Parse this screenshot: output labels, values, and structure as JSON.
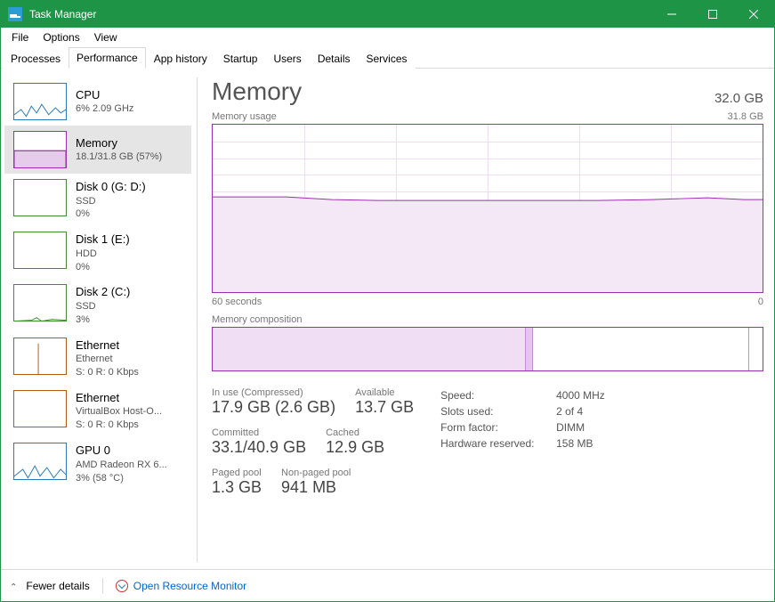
{
  "window": {
    "title": "Task Manager"
  },
  "menus": [
    "File",
    "Options",
    "View"
  ],
  "tabs": [
    "Processes",
    "Performance",
    "App history",
    "Startup",
    "Users",
    "Details",
    "Services"
  ],
  "activeTab": 1,
  "selectedSide": 1,
  "sidebar": [
    {
      "title": "CPU",
      "sub1": "6% 2.09 GHz",
      "sub2": "",
      "color": "#2a7ab9"
    },
    {
      "title": "Memory",
      "sub1": "18.1/31.8 GB (57%)",
      "sub2": "",
      "color": "#9b2fae"
    },
    {
      "title": "Disk 0 (G: D:)",
      "sub1": "SSD",
      "sub2": "0%",
      "color": "#3f8f2f"
    },
    {
      "title": "Disk 1 (E:)",
      "sub1": "HDD",
      "sub2": "0%",
      "color": "#3f8f2f"
    },
    {
      "title": "Disk 2 (C:)",
      "sub1": "SSD",
      "sub2": "3%",
      "color": "#3f8f2f"
    },
    {
      "title": "Ethernet",
      "sub1": "Ethernet",
      "sub2": "S: 0 R: 0 Kbps",
      "color": "#b05a12"
    },
    {
      "title": "Ethernet",
      "sub1": "VirtualBox Host-O...",
      "sub2": "S: 0 R: 0 Kbps",
      "color": "#b05a12"
    },
    {
      "title": "GPU 0",
      "sub1": "AMD Radeon RX 6...",
      "sub2": "3% (58 °C)",
      "color": "#2a7ab9"
    }
  ],
  "main": {
    "title": "Memory",
    "capacity": "32.0 GB",
    "usageLabel": "Memory usage",
    "usageMax": "31.8 GB",
    "xLeft": "60 seconds",
    "xRight": "0",
    "compLabel": "Memory composition",
    "stats": {
      "inuse_lbl": "In use (Compressed)",
      "inuse_val": "17.9 GB (2.6 GB)",
      "avail_lbl": "Available",
      "avail_val": "13.7 GB",
      "committed_lbl": "Committed",
      "committed_val": "33.1/40.9 GB",
      "cached_lbl": "Cached",
      "cached_val": "12.9 GB",
      "paged_lbl": "Paged pool",
      "paged_val": "1.3 GB",
      "nonpaged_lbl": "Non-paged pool",
      "nonpaged_val": "941 MB"
    },
    "kv": [
      {
        "k": "Speed:",
        "v": "4000 MHz"
      },
      {
        "k": "Slots used:",
        "v": "2 of 4"
      },
      {
        "k": "Form factor:",
        "v": "DIMM"
      },
      {
        "k": "Hardware reserved:",
        "v": "158 MB"
      }
    ]
  },
  "footer": {
    "fewer": "Fewer details",
    "link": "Open Resource Monitor"
  },
  "chart_data": {
    "type": "line",
    "title": "Memory usage",
    "xlabel": "seconds",
    "ylabel": "GB",
    "xlim": [
      60,
      0
    ],
    "ylim": [
      0,
      31.8
    ],
    "series": [
      {
        "name": "In use",
        "x": [
          60,
          55,
          50,
          45,
          40,
          35,
          30,
          25,
          20,
          15,
          10,
          5,
          0
        ],
        "values": [
          18.3,
          18.3,
          18.2,
          18.1,
          18.1,
          18.1,
          18.0,
          18.0,
          18.0,
          18.0,
          18.1,
          18.2,
          18.1
        ]
      }
    ],
    "composition": {
      "in_use_pct": 57,
      "modified_pct": 1,
      "standby_pct": 40,
      "free_pct": 2
    }
  }
}
